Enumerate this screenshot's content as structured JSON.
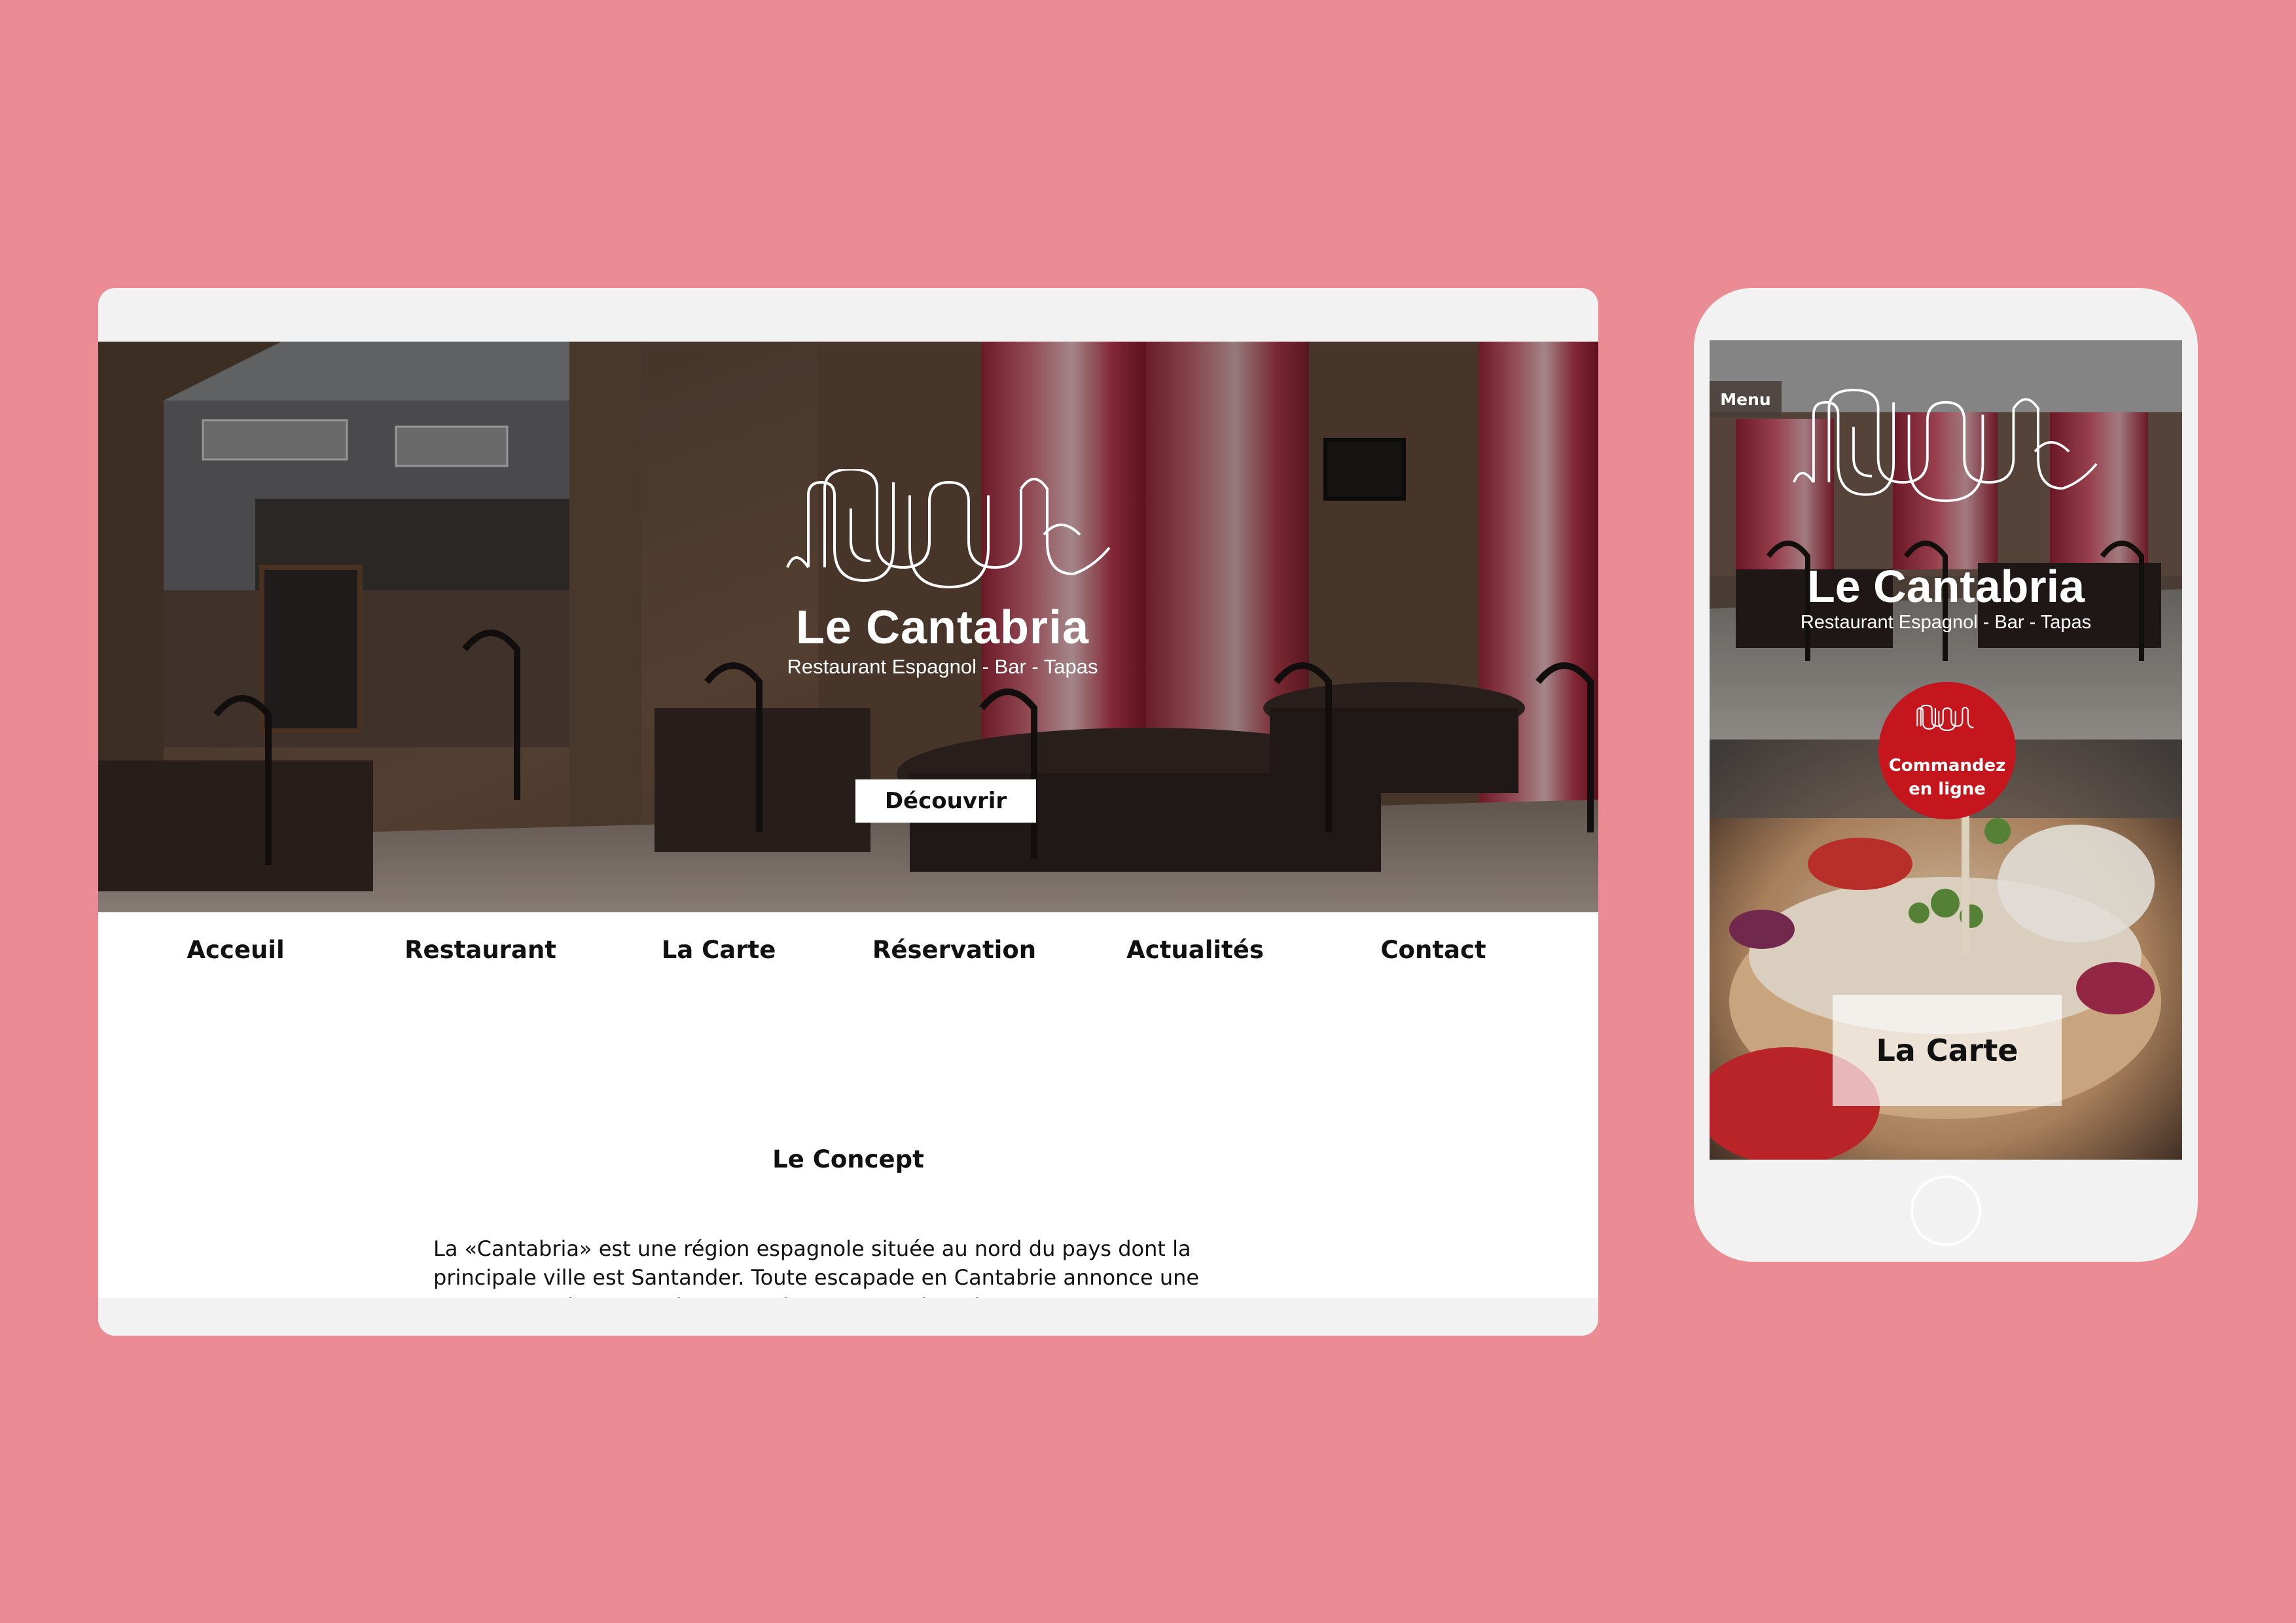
{
  "desktop": {
    "brand": {
      "name": "Le Cantabria",
      "tagline": "Restaurant Espagnol - Bar - Tapas"
    },
    "hero_button": "Découvrir",
    "nav": [
      {
        "label": "Acceuil"
      },
      {
        "label": "Restaurant"
      },
      {
        "label": "La Carte"
      },
      {
        "label": "Réservation"
      },
      {
        "label": "Actualités"
      },
      {
        "label": "Contact"
      }
    ],
    "concept": {
      "title": "Le Concept",
      "text": "La «Cantabria» est une région espagnole située au nord du pays dont la principale ville est Santander. Toute escapade en Cantabrie annonce une rencontre unique avec la nature, la gastronomie et l'art."
    }
  },
  "mobile": {
    "menu_button": "Menu",
    "brand": {
      "name": "Le Cantabria",
      "tagline": "Restaurant Espagnol - Bar - Tapas"
    },
    "order_button": {
      "line1": "Commandez",
      "line2": "en ligne"
    },
    "section_label": "La Carte"
  },
  "icons": {
    "logo": "cantabria-logo-icon",
    "home": "home-button-icon"
  },
  "colors": {
    "background": "#eb8c94",
    "device_frame": "#f2f2f2",
    "accent_red": "#c4161c",
    "text": "#111111"
  }
}
